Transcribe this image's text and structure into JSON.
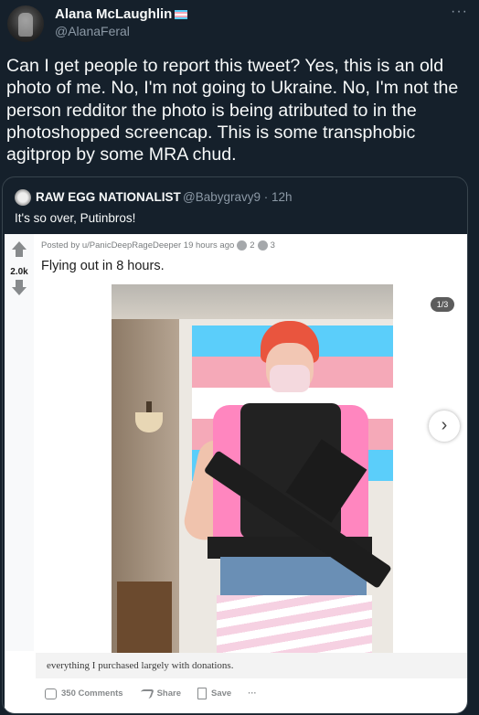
{
  "tweet": {
    "author_name": "Alana McLaughlin",
    "author_handle": "@AlanaFeral",
    "more_label": "···",
    "text": "Can I get people to report this tweet? Yes, this is an old photo of me. No, I'm not going to Ukraine. No, I'm not the person redditor the photo is being atributed to in the photoshopped screencap. This is some transphobic agitprop by some MRA chud."
  },
  "quote": {
    "author_name": "RAW EGG NATIONALIST",
    "author_handle": "@Babygravy9 · 12h",
    "text": "It's so over, Putinbros!"
  },
  "reddit": {
    "score": "2.0k",
    "posted_by": "Posted by u/PanicDeepRageDeeper 19 hours ago",
    "award_count_1": "2",
    "award_count_2": "3",
    "title": "Flying out in 8 hours.",
    "gallery_counter": "1/3",
    "next_glyph": "›",
    "caption": "everything I purchased largely with donations.",
    "comments_label": "350 Comments",
    "share_label": "Share",
    "save_label": "Save",
    "more_label": "···"
  },
  "colors": {
    "background": "#15202b",
    "text": "#f7f9f9",
    "muted": "#8b98a5",
    "border": "#38444d",
    "flag_blue": "#5bcefa",
    "flag_pink": "#f5a9b8",
    "flag_white": "#ffffff"
  }
}
